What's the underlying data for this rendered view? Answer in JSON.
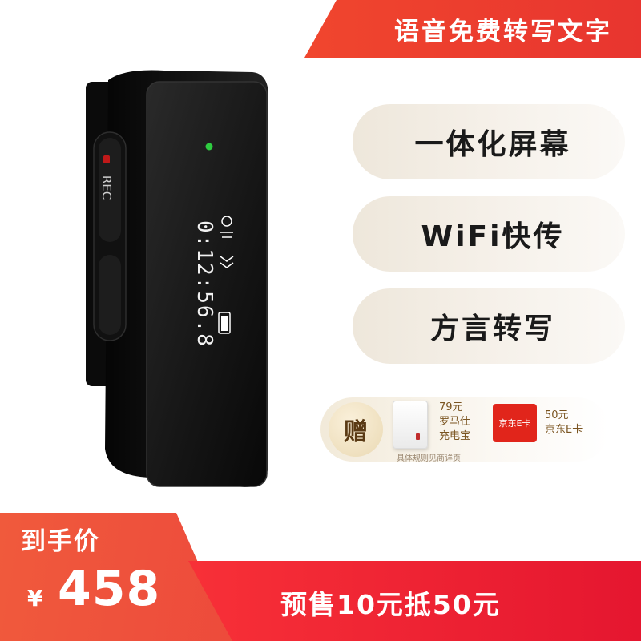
{
  "banner": {
    "text": "语音免费转写文字"
  },
  "features": [
    "一体化屏幕",
    "WiFi快传",
    "方言转写"
  ],
  "gift": {
    "label": "赠",
    "item1_price": "79元",
    "item1_name_line1": "罗马仕",
    "item1_name_line2": "充电宝",
    "card_label": "京东E卡",
    "item2_price": "50元",
    "item2_name": "京东E卡",
    "note": "具体规则见商详页"
  },
  "device": {
    "rec_label": "REC",
    "time": "0:12:56.8",
    "led_color": "#2ecc40"
  },
  "price": {
    "label": "到手价",
    "currency": "¥",
    "value": "458",
    "presale": "预售10元抵50元"
  },
  "colors": {
    "accent": "#e8352f",
    "gold": "#7a5420"
  }
}
